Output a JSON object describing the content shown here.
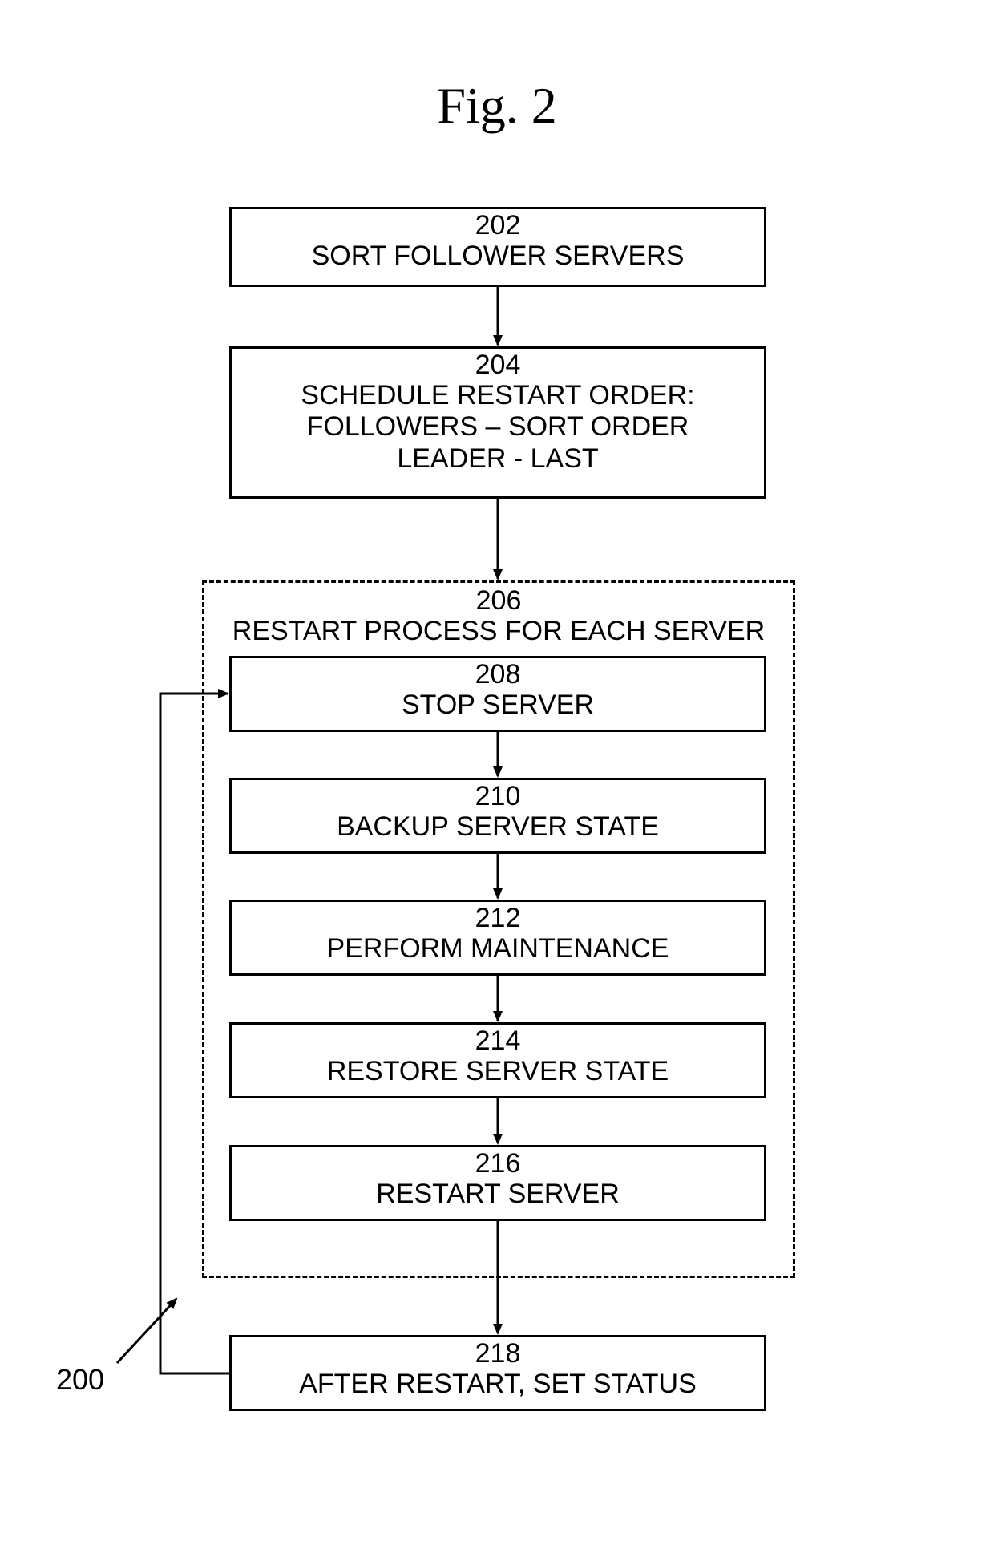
{
  "figure": {
    "title": "Fig. 2",
    "ref": "200"
  },
  "boxes": {
    "b202": {
      "num": "202",
      "text": "SORT FOLLOWER SERVERS"
    },
    "b204": {
      "num": "204",
      "text": "SCHEDULE RESTART ORDER:\nFOLLOWERS – SORT ORDER\nLEADER - LAST"
    },
    "b206": {
      "num": "206",
      "text": "RESTART PROCESS FOR EACH SERVER"
    },
    "b208": {
      "num": "208",
      "text": "STOP SERVER"
    },
    "b210": {
      "num": "210",
      "text": "BACKUP SERVER STATE"
    },
    "b212": {
      "num": "212",
      "text": "PERFORM MAINTENANCE"
    },
    "b214": {
      "num": "214",
      "text": "RESTORE SERVER STATE"
    },
    "b216": {
      "num": "216",
      "text": "RESTART SERVER"
    },
    "b218": {
      "num": "218",
      "text": "AFTER RESTART, SET STATUS"
    }
  }
}
